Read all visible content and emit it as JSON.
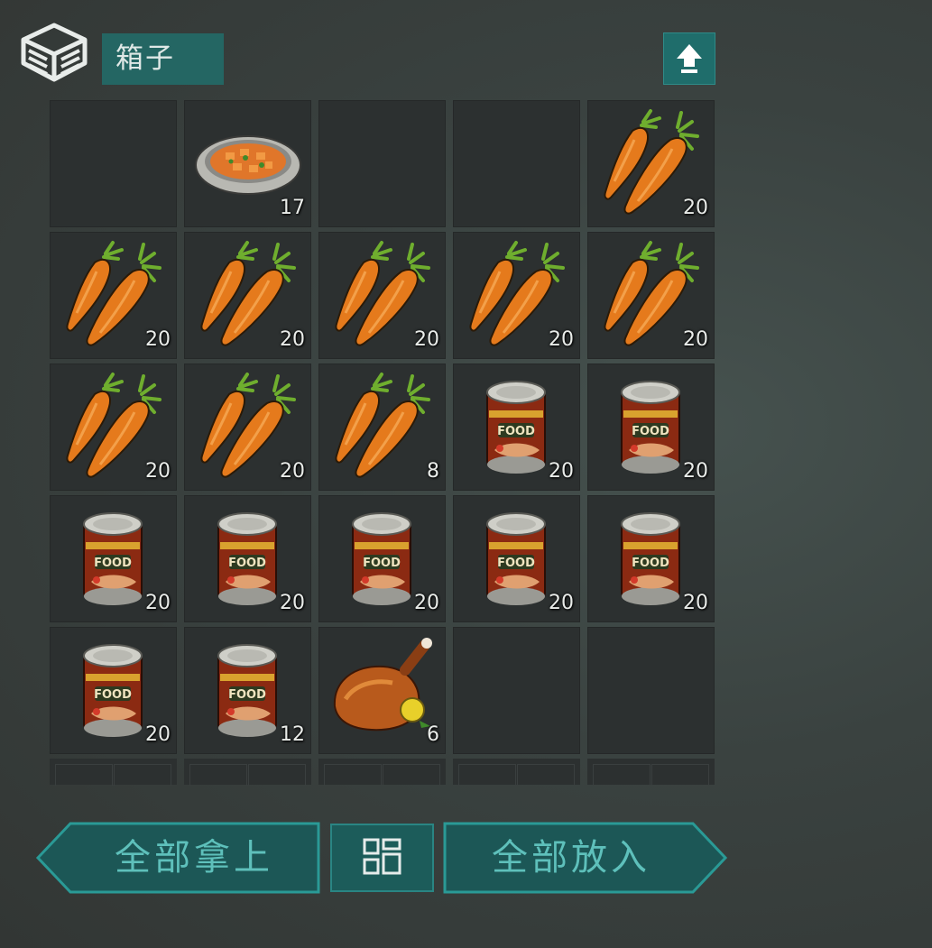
{
  "container": {
    "title": "箱子",
    "icon": "box-stack-icon",
    "upload_icon": "upload-arrow-icon"
  },
  "slots": [
    {
      "item": "empty",
      "count": ""
    },
    {
      "item": "stew-bowl",
      "count": "17"
    },
    {
      "item": "empty",
      "count": ""
    },
    {
      "item": "empty",
      "count": ""
    },
    {
      "item": "carrot",
      "count": "20"
    },
    {
      "item": "carrot",
      "count": "20"
    },
    {
      "item": "carrot",
      "count": "20"
    },
    {
      "item": "carrot",
      "count": "20"
    },
    {
      "item": "carrot",
      "count": "20"
    },
    {
      "item": "carrot",
      "count": "20"
    },
    {
      "item": "carrot",
      "count": "20"
    },
    {
      "item": "carrot",
      "count": "20"
    },
    {
      "item": "carrot",
      "count": "8"
    },
    {
      "item": "canned-food",
      "count": "20"
    },
    {
      "item": "canned-food",
      "count": "20"
    },
    {
      "item": "canned-food",
      "count": "20"
    },
    {
      "item": "canned-food",
      "count": "20"
    },
    {
      "item": "canned-food",
      "count": "20"
    },
    {
      "item": "canned-food",
      "count": "20"
    },
    {
      "item": "canned-food",
      "count": "20"
    },
    {
      "item": "canned-food",
      "count": "20"
    },
    {
      "item": "canned-food",
      "count": "12"
    },
    {
      "item": "roast-chicken",
      "count": "6"
    },
    {
      "item": "empty",
      "count": ""
    },
    {
      "item": "empty",
      "count": ""
    }
  ],
  "actions": {
    "take_all": "全部拿上",
    "put_all": "全部放入",
    "sort_icon": "sort-grid-icon"
  },
  "colors": {
    "accent": "#1f6d6b",
    "button_text": "#5ec0bb",
    "slot_bg": "#2c3030"
  }
}
